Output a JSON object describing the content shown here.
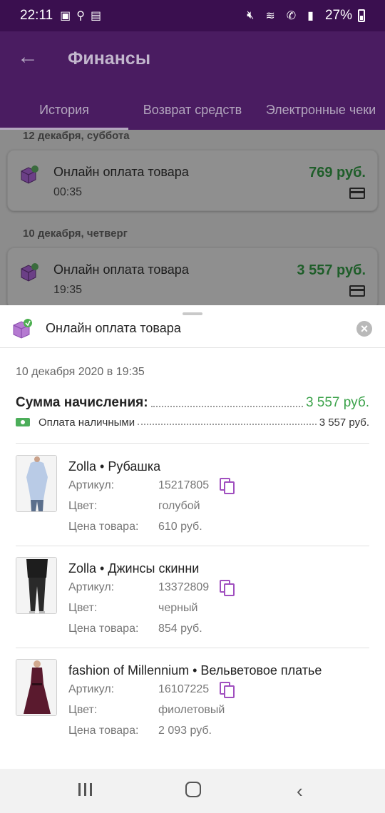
{
  "status_bar": {
    "time": "22:11",
    "battery": "27%",
    "icons": [
      "image-icon",
      "search-icon",
      "app-icon",
      "mute-icon",
      "wifi-icon",
      "call-icon",
      "signal-icon",
      "battery-icon"
    ]
  },
  "app_bar": {
    "title": "Финансы",
    "tabs": [
      {
        "label": "История",
        "active": true
      },
      {
        "label": "Возврат средств",
        "active": false
      },
      {
        "label": "Электронные чеки",
        "active": false
      }
    ]
  },
  "history": [
    {
      "date": "12 декабря, суббота",
      "name": "Онлайн оплата товара",
      "time": "00:35",
      "amount": "769 руб."
    },
    {
      "date": "10 декабря, четверг",
      "name": "Онлайн оплата товара",
      "time": "19:35",
      "amount": "3 557 руб."
    }
  ],
  "sheet": {
    "title": "Онлайн оплата товара",
    "datetime": "10 декабря 2020 в 19:35",
    "sum_label": "Сумма начисления:",
    "sum_value": "3 557 руб.",
    "payment_label": "Оплата наличными",
    "payment_value": "3 557 руб.",
    "field_labels": {
      "article": "Артикул:",
      "color": "Цвет:",
      "price": "Цена товара:"
    },
    "items": [
      {
        "name": "Zolla • Рубашка",
        "article": "15217805",
        "color": "голубой",
        "price": "610 руб."
      },
      {
        "name": "Zolla • Джинсы скинни",
        "article": "13372809",
        "color": "черный",
        "price": "854 руб."
      },
      {
        "name": "fashion of Millennium • Вельветовое платье",
        "article": "16107225",
        "color": "фиолетовый",
        "price": "2 093 руб."
      }
    ]
  },
  "colors": {
    "accent_purple": "#4a1c61",
    "amount_green": "#3ba24a",
    "copy_icon": "#a04fbf"
  }
}
